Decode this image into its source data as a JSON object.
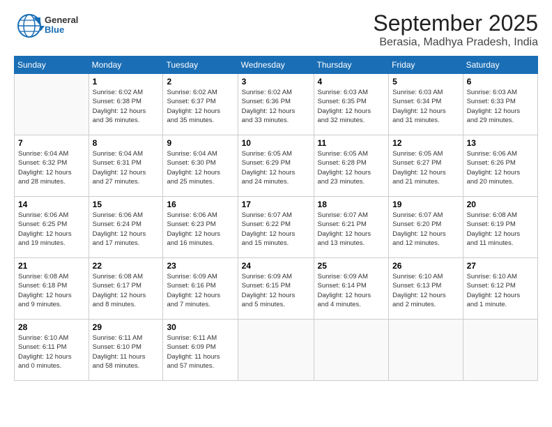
{
  "header": {
    "logo_line1": "General",
    "logo_line2": "Blue",
    "month": "September 2025",
    "location": "Berasia, Madhya Pradesh, India"
  },
  "weekdays": [
    "Sunday",
    "Monday",
    "Tuesday",
    "Wednesday",
    "Thursday",
    "Friday",
    "Saturday"
  ],
  "weeks": [
    [
      {
        "day": "",
        "info": ""
      },
      {
        "day": "1",
        "info": "Sunrise: 6:02 AM\nSunset: 6:38 PM\nDaylight: 12 hours\nand 36 minutes."
      },
      {
        "day": "2",
        "info": "Sunrise: 6:02 AM\nSunset: 6:37 PM\nDaylight: 12 hours\nand 35 minutes."
      },
      {
        "day": "3",
        "info": "Sunrise: 6:02 AM\nSunset: 6:36 PM\nDaylight: 12 hours\nand 33 minutes."
      },
      {
        "day": "4",
        "info": "Sunrise: 6:03 AM\nSunset: 6:35 PM\nDaylight: 12 hours\nand 32 minutes."
      },
      {
        "day": "5",
        "info": "Sunrise: 6:03 AM\nSunset: 6:34 PM\nDaylight: 12 hours\nand 31 minutes."
      },
      {
        "day": "6",
        "info": "Sunrise: 6:03 AM\nSunset: 6:33 PM\nDaylight: 12 hours\nand 29 minutes."
      }
    ],
    [
      {
        "day": "7",
        "info": "Sunrise: 6:04 AM\nSunset: 6:32 PM\nDaylight: 12 hours\nand 28 minutes."
      },
      {
        "day": "8",
        "info": "Sunrise: 6:04 AM\nSunset: 6:31 PM\nDaylight: 12 hours\nand 27 minutes."
      },
      {
        "day": "9",
        "info": "Sunrise: 6:04 AM\nSunset: 6:30 PM\nDaylight: 12 hours\nand 25 minutes."
      },
      {
        "day": "10",
        "info": "Sunrise: 6:05 AM\nSunset: 6:29 PM\nDaylight: 12 hours\nand 24 minutes."
      },
      {
        "day": "11",
        "info": "Sunrise: 6:05 AM\nSunset: 6:28 PM\nDaylight: 12 hours\nand 23 minutes."
      },
      {
        "day": "12",
        "info": "Sunrise: 6:05 AM\nSunset: 6:27 PM\nDaylight: 12 hours\nand 21 minutes."
      },
      {
        "day": "13",
        "info": "Sunrise: 6:06 AM\nSunset: 6:26 PM\nDaylight: 12 hours\nand 20 minutes."
      }
    ],
    [
      {
        "day": "14",
        "info": "Sunrise: 6:06 AM\nSunset: 6:25 PM\nDaylight: 12 hours\nand 19 minutes."
      },
      {
        "day": "15",
        "info": "Sunrise: 6:06 AM\nSunset: 6:24 PM\nDaylight: 12 hours\nand 17 minutes."
      },
      {
        "day": "16",
        "info": "Sunrise: 6:06 AM\nSunset: 6:23 PM\nDaylight: 12 hours\nand 16 minutes."
      },
      {
        "day": "17",
        "info": "Sunrise: 6:07 AM\nSunset: 6:22 PM\nDaylight: 12 hours\nand 15 minutes."
      },
      {
        "day": "18",
        "info": "Sunrise: 6:07 AM\nSunset: 6:21 PM\nDaylight: 12 hours\nand 13 minutes."
      },
      {
        "day": "19",
        "info": "Sunrise: 6:07 AM\nSunset: 6:20 PM\nDaylight: 12 hours\nand 12 minutes."
      },
      {
        "day": "20",
        "info": "Sunrise: 6:08 AM\nSunset: 6:19 PM\nDaylight: 12 hours\nand 11 minutes."
      }
    ],
    [
      {
        "day": "21",
        "info": "Sunrise: 6:08 AM\nSunset: 6:18 PM\nDaylight: 12 hours\nand 9 minutes."
      },
      {
        "day": "22",
        "info": "Sunrise: 6:08 AM\nSunset: 6:17 PM\nDaylight: 12 hours\nand 8 minutes."
      },
      {
        "day": "23",
        "info": "Sunrise: 6:09 AM\nSunset: 6:16 PM\nDaylight: 12 hours\nand 7 minutes."
      },
      {
        "day": "24",
        "info": "Sunrise: 6:09 AM\nSunset: 6:15 PM\nDaylight: 12 hours\nand 5 minutes."
      },
      {
        "day": "25",
        "info": "Sunrise: 6:09 AM\nSunset: 6:14 PM\nDaylight: 12 hours\nand 4 minutes."
      },
      {
        "day": "26",
        "info": "Sunrise: 6:10 AM\nSunset: 6:13 PM\nDaylight: 12 hours\nand 2 minutes."
      },
      {
        "day": "27",
        "info": "Sunrise: 6:10 AM\nSunset: 6:12 PM\nDaylight: 12 hours\nand 1 minute."
      }
    ],
    [
      {
        "day": "28",
        "info": "Sunrise: 6:10 AM\nSunset: 6:11 PM\nDaylight: 12 hours\nand 0 minutes."
      },
      {
        "day": "29",
        "info": "Sunrise: 6:11 AM\nSunset: 6:10 PM\nDaylight: 11 hours\nand 58 minutes."
      },
      {
        "day": "30",
        "info": "Sunrise: 6:11 AM\nSunset: 6:09 PM\nDaylight: 11 hours\nand 57 minutes."
      },
      {
        "day": "",
        "info": ""
      },
      {
        "day": "",
        "info": ""
      },
      {
        "day": "",
        "info": ""
      },
      {
        "day": "",
        "info": ""
      }
    ]
  ]
}
